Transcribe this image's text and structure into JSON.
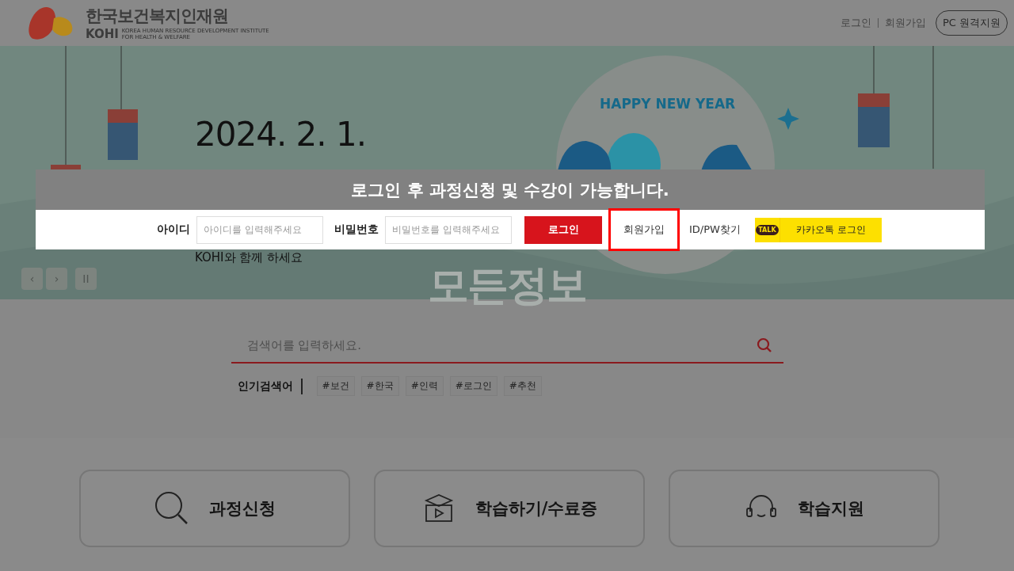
{
  "header": {
    "logo_title": "한국보건복지인재원",
    "logo_abbr": "KOHI",
    "logo_subtitle": [
      "KOREA HUMAN RESOURCE DEVELOPMENT INSTITUTE",
      "FOR HEALTH & WELFARE"
    ],
    "links": [
      "로그인",
      "회원가입"
    ],
    "remote_button": "PC 원격지원"
  },
  "banner": {
    "date": "2024. 2. 1.",
    "caption": "KOHI와 함께 하세요",
    "greeting": "HAPPY NEW YEAR",
    "controls": [
      {
        "kind": "prev",
        "label": "‹"
      },
      {
        "kind": "next",
        "label": "›"
      },
      {
        "kind": "pause",
        "label": "II"
      }
    ]
  },
  "login_popup": {
    "notice": "로그인 후 과정신청 및 수강이 가능합니다.",
    "id_label": "아이디",
    "id_placeholder": "아이디를 입력해주세요",
    "pw_label": "비밀번호",
    "pw_placeholder": "비밀번호를 입력해주세요",
    "login_button": "로그인",
    "links": [
      {
        "label": "회원가입",
        "highlighted": true
      },
      {
        "label": "ID/PW찾기",
        "highlighted": false
      }
    ],
    "kakao_badge": "TALK",
    "kakao_button": "카카오톡 로그인"
  },
  "search": {
    "heading": "모든정보",
    "placeholder": "검색어를 입력하세요.",
    "popular_label": "인기검색어",
    "tags": [
      "#보건",
      "#한국",
      "#인력",
      "#로그인",
      "#추천"
    ]
  },
  "quick_menu": [
    {
      "kind": "search",
      "label": "과정신청"
    },
    {
      "kind": "lecture",
      "label": "학습하기/수료증"
    },
    {
      "kind": "support",
      "label": "학습지원"
    }
  ]
}
